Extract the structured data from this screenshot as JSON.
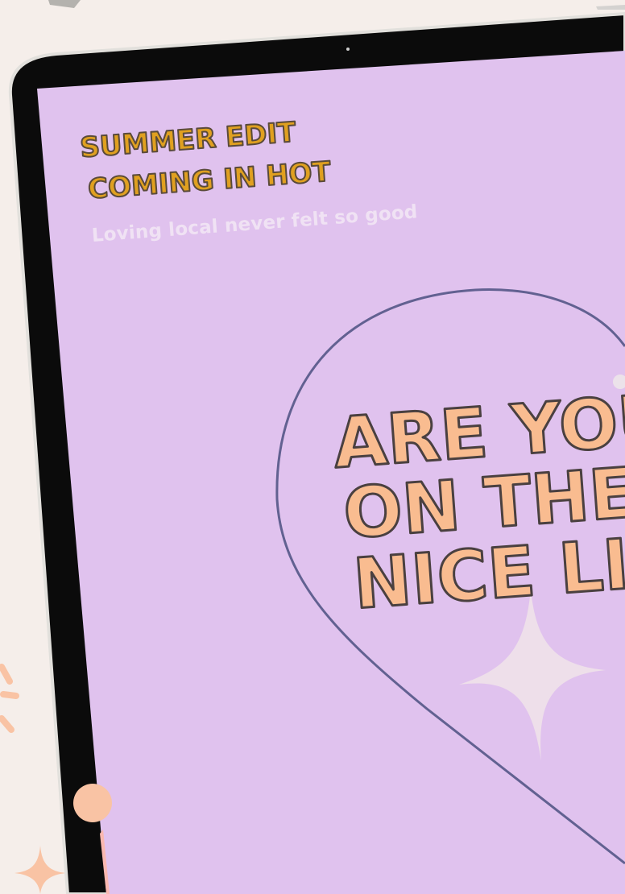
{
  "poster": {
    "headline_lines": [
      "SUMMER EDIT",
      "COMING IN HOT"
    ],
    "subtitle": "Loving local never felt so good",
    "bubble_lines": [
      "ARE YOU",
      "ON THE",
      "NICE LIS"
    ]
  },
  "colors": {
    "page_background": "#f5eeea",
    "device_bezel": "#0b0b0b",
    "screen": "#e0c2ee",
    "headline_fill": "#e0a020",
    "headline_outline": "#5a4a3a",
    "bubble_text_fill": "#f9bc90",
    "bubble_text_outline": "#4a4040",
    "bubble_outline": "#626191",
    "sparkle": "#eedfea",
    "accent_peach": "#f9c3a4"
  }
}
